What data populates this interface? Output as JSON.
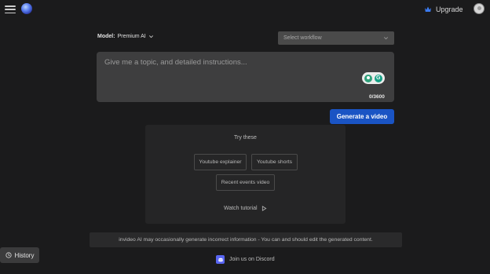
{
  "header": {
    "upgrade_label": "Upgrade",
    "icons": {
      "menu": "hamburger-menu-icon",
      "logo": "invideo-logo",
      "crown": "crown-icon",
      "avatar": "user-avatar"
    },
    "colors": {
      "crown": "#3b7bf0"
    }
  },
  "model": {
    "label": "Model:",
    "value": "Premium AI"
  },
  "workflow": {
    "placeholder": "Select workflow"
  },
  "prompt": {
    "placeholder": "Give me a topic, and detailed instructions...",
    "counter": "0/3600"
  },
  "generate_button": {
    "label": "Generate a video",
    "color": "#1a54c4"
  },
  "suggestions": {
    "heading": "Try these",
    "chips": [
      "Youtube explainer",
      "Youtube shorts",
      "Recent events video"
    ],
    "tutorial_label": "Watch tutorial"
  },
  "notice": "invideo AI may occasionally generate incorrect information - You can and should edit the generated content.",
  "discord_label": "Join us on Discord",
  "history_label": "History"
}
